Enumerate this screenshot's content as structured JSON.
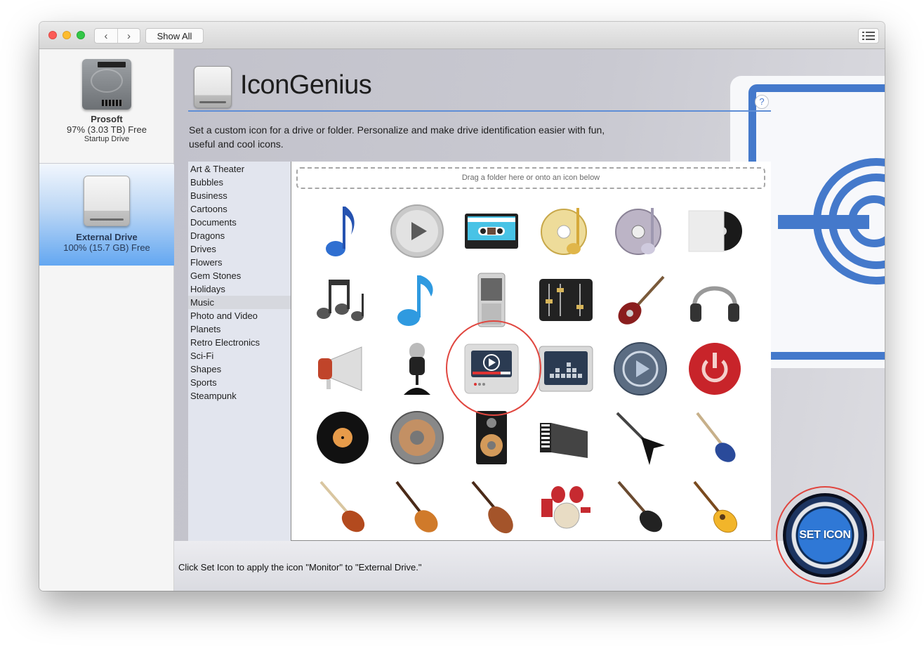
{
  "window": {
    "nav_back": "<",
    "nav_forward": ">",
    "show_all_label": "Show All",
    "list_view_icon": "list-icon"
  },
  "drives": [
    {
      "name": "Prosoft",
      "free": "97% (3.03 TB) Free",
      "subtitle": "Startup Drive",
      "icon": "hard-drive-icon",
      "selected": false
    },
    {
      "name": "External Drive",
      "free": "100% (15.7 GB) Free",
      "subtitle": "",
      "icon": "external-drive-icon",
      "selected": true
    }
  ],
  "header": {
    "title": "IconGenius",
    "description": "Set a custom icon for a drive or folder. Personalize and make drive identification easier with fun, useful and cool icons.",
    "help_label": "?"
  },
  "categories": {
    "selected": "Music",
    "items": [
      "Art & Theater",
      "Bubbles",
      "Business",
      "Cartoons",
      "Documents",
      "Dragons",
      "Drives",
      "Flowers",
      "Gem Stones",
      "Holidays",
      "Music",
      "Photo and Video",
      "Planets",
      "Retro Electronics",
      "Sci-Fi",
      "Shapes",
      "Sports",
      "Steampunk"
    ]
  },
  "dropzone": {
    "text": "Drag a folder here or onto an icon below"
  },
  "icons": [
    {
      "name": "blue-music-note"
    },
    {
      "name": "silver-play-button"
    },
    {
      "name": "cassette-tape"
    },
    {
      "name": "gold-cd-music"
    },
    {
      "name": "silver-cd-music"
    },
    {
      "name": "vinyl-sleeve"
    },
    {
      "name": "music-notes"
    },
    {
      "name": "blue-eighth-note"
    },
    {
      "name": "mobile-music-player"
    },
    {
      "name": "mixer-faders"
    },
    {
      "name": "red-electric-guitar"
    },
    {
      "name": "headphones"
    },
    {
      "name": "megaphone"
    },
    {
      "name": "microphone"
    },
    {
      "name": "monitor",
      "selected": true
    },
    {
      "name": "equalizer-display"
    },
    {
      "name": "blue-play-button"
    },
    {
      "name": "red-power-button"
    },
    {
      "name": "vinyl-record"
    },
    {
      "name": "speaker-woofer"
    },
    {
      "name": "speaker-cabinet"
    },
    {
      "name": "accordion"
    },
    {
      "name": "flying-v-guitar"
    },
    {
      "name": "blue-stratocaster"
    },
    {
      "name": "sunburst-stratocaster"
    },
    {
      "name": "les-paul-guitar"
    },
    {
      "name": "violin"
    },
    {
      "name": "drum-kit"
    },
    {
      "name": "black-stratocaster"
    },
    {
      "name": "acoustic-guitar"
    }
  ],
  "footer": {
    "status": "Click Set Icon to apply the icon \"Monitor\" to \"External Drive.\"",
    "set_icon_label": "SET ICON"
  },
  "colors": {
    "accent": "#4479cb",
    "highlight_ring": "#e0463f",
    "selected_drive": "#63a7f1"
  }
}
